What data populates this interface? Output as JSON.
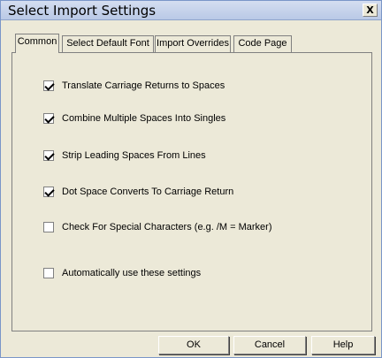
{
  "window": {
    "title": "Select Import Settings",
    "close_label": "X"
  },
  "tabs": [
    {
      "label": "Common",
      "active": true
    },
    {
      "label": "Select Default Font",
      "active": false
    },
    {
      "label": "Import Overrides",
      "active": false
    },
    {
      "label": "Code Page",
      "active": false
    }
  ],
  "options": [
    {
      "label": "Translate Carriage Returns to Spaces",
      "checked": true
    },
    {
      "label": "Combine Multiple Spaces Into Singles",
      "checked": true
    },
    {
      "label": "Strip Leading Spaces From Lines",
      "checked": true
    },
    {
      "label": "Dot Space Converts To Carriage Return",
      "checked": true
    },
    {
      "label": "Check For Special Characters (e.g. /M = Marker)",
      "checked": false
    },
    {
      "label": "Automatically use these settings",
      "checked": false
    }
  ],
  "buttons": {
    "ok": "OK",
    "cancel": "Cancel",
    "help": "Help"
  }
}
